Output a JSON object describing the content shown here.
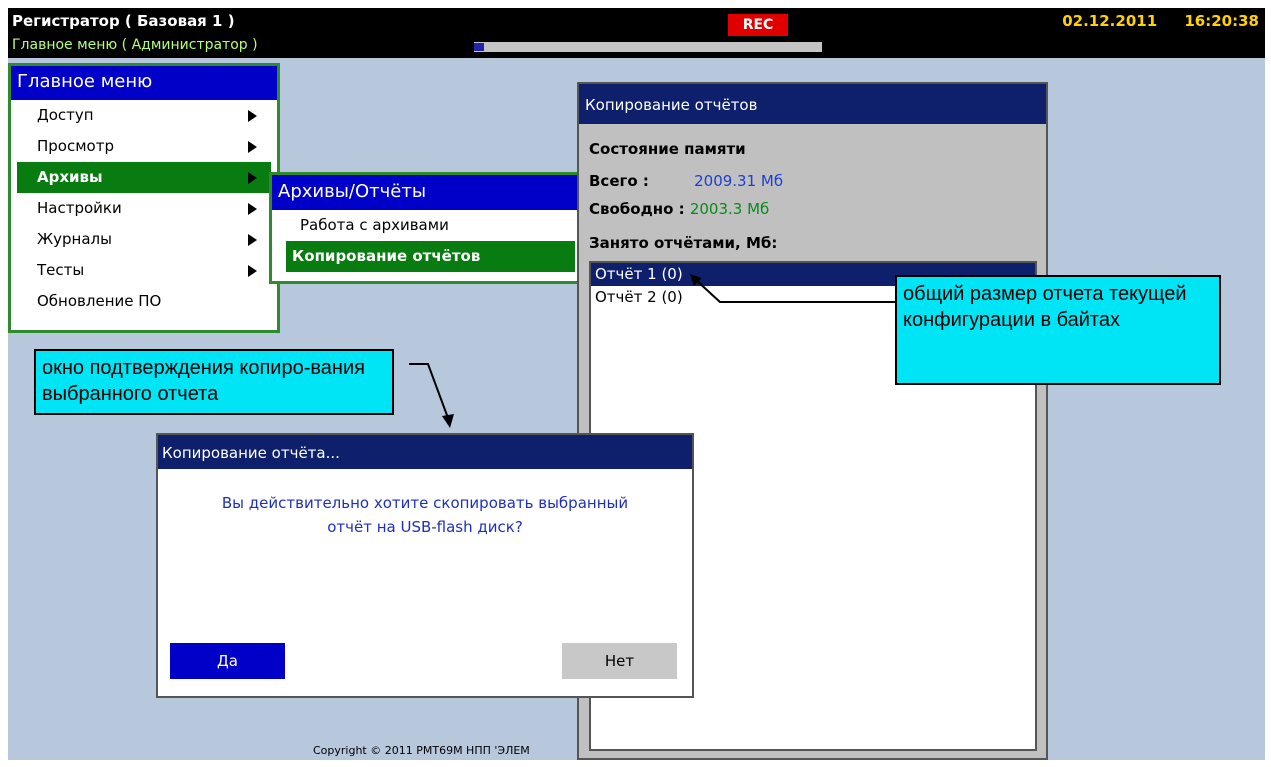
{
  "header": {
    "title": "Регистратор ( Базовая 1 )",
    "subtitle": "Главное меню ( Администратор )",
    "rec": "REC",
    "date": "02.12.2011",
    "time": "16:20:38",
    "progress": 0.03
  },
  "main_menu": {
    "title": "Главное меню",
    "items": [
      {
        "label": "Доступ",
        "has_submenu": true
      },
      {
        "label": "Просмотр",
        "has_submenu": true
      },
      {
        "label": "Архивы",
        "has_submenu": true,
        "active": true
      },
      {
        "label": "Настройки",
        "has_submenu": true
      },
      {
        "label": "Журналы",
        "has_submenu": true
      },
      {
        "label": "Тесты",
        "has_submenu": true
      },
      {
        "label": "Обновление ПО",
        "has_submenu": false
      }
    ]
  },
  "sub_menu": {
    "title": "Архивы/Отчёты",
    "items": [
      {
        "label": "Работа с архивами"
      },
      {
        "label": "Копирование отчётов",
        "active": true
      }
    ]
  },
  "copy_panel": {
    "title": "Копирование отчётов",
    "memory_state": "Состояние памяти",
    "total_label": "Всего :",
    "total_value": "2009.31 Мб",
    "free_label": "Свободно :",
    "free_value": "2003.3 Мб",
    "used_label": "Занято отчётами, Мб:",
    "reports": [
      {
        "label": "Отчёт 1 (0)",
        "selected": true
      },
      {
        "label": "Отчёт 2 (0)",
        "selected": false
      }
    ]
  },
  "callouts": {
    "right": "общий размер отчета текущей конфигурации в байтах",
    "left": "окно подтверждения копиро-вания выбранного отчета"
  },
  "dialog": {
    "title": "Копирование отчёта...",
    "message_line1": "Вы действительно хотите скопировать выбранный",
    "message_line2": "отчёт на USB-flash диск?",
    "yes": "Да",
    "no": "Нет"
  },
  "footer": {
    "copyright": "Copyright © 2011 РМТ69М НПП 'ЭЛЕМ"
  },
  "colors": {
    "background": "#b7c8dd",
    "menu_title": "#0000c8",
    "active_item": "#087c10",
    "callout": "#00e5f5",
    "rec": "#e00000",
    "datetime": "#ffd200"
  }
}
